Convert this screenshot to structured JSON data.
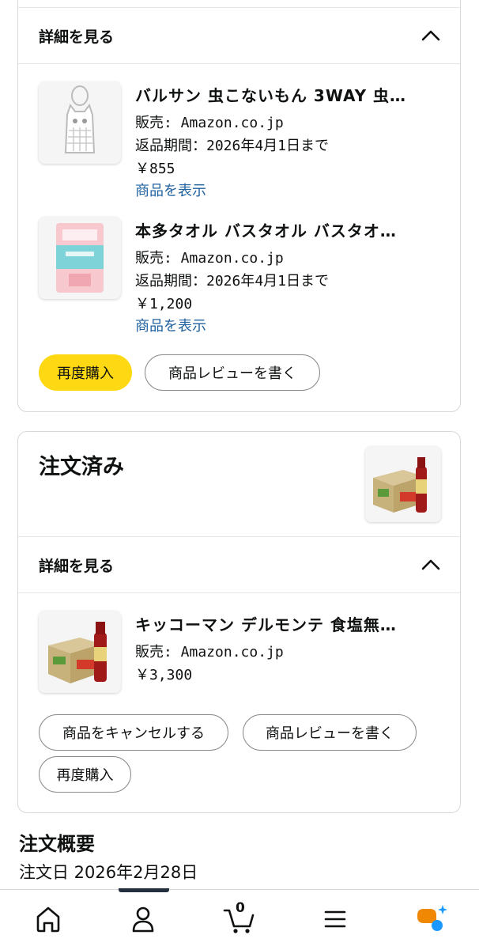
{
  "order1": {
    "details_label": "詳細を見る",
    "items": [
      {
        "title": "バルサン 虫こないもん 3WAY 虫…",
        "seller": "販売: Amazon.co.jp",
        "return": "返品期間：2026年4月1日まで",
        "price": "￥855",
        "view_link": "商品を表示"
      },
      {
        "title": "本多タオル バスタオル バスタオ…",
        "seller": "販売: Amazon.co.jp",
        "return": "返品期間：2026年4月1日まで",
        "price": "￥1,200",
        "view_link": "商品を表示"
      }
    ],
    "rebuy_label": "再度購入",
    "review_label": "商品レビューを書く"
  },
  "order2": {
    "status": "注文済み",
    "details_label": "詳細を見る",
    "item": {
      "title": "キッコーマン デルモンテ 食塩無…",
      "seller": "販売: Amazon.co.jp",
      "price": "￥3,300"
    },
    "cancel_label": "商品をキャンセルする",
    "review_label": "商品レビューを書く",
    "rebuy_label": "再度購入"
  },
  "summary": {
    "title": "注文概要",
    "order_date": "注文日 2026年2月28日"
  },
  "nav": {
    "cart_count": "0",
    "items": [
      "home-icon",
      "account-icon",
      "cart-icon",
      "menu-icon",
      "rufus-icon"
    ]
  },
  "colors": {
    "accent_yellow": "#ffd814",
    "link_blue": "#2162a1",
    "border": "#d5d9d9",
    "rufus_orange": "#f08804",
    "rufus_blue": "#1a98ff"
  }
}
